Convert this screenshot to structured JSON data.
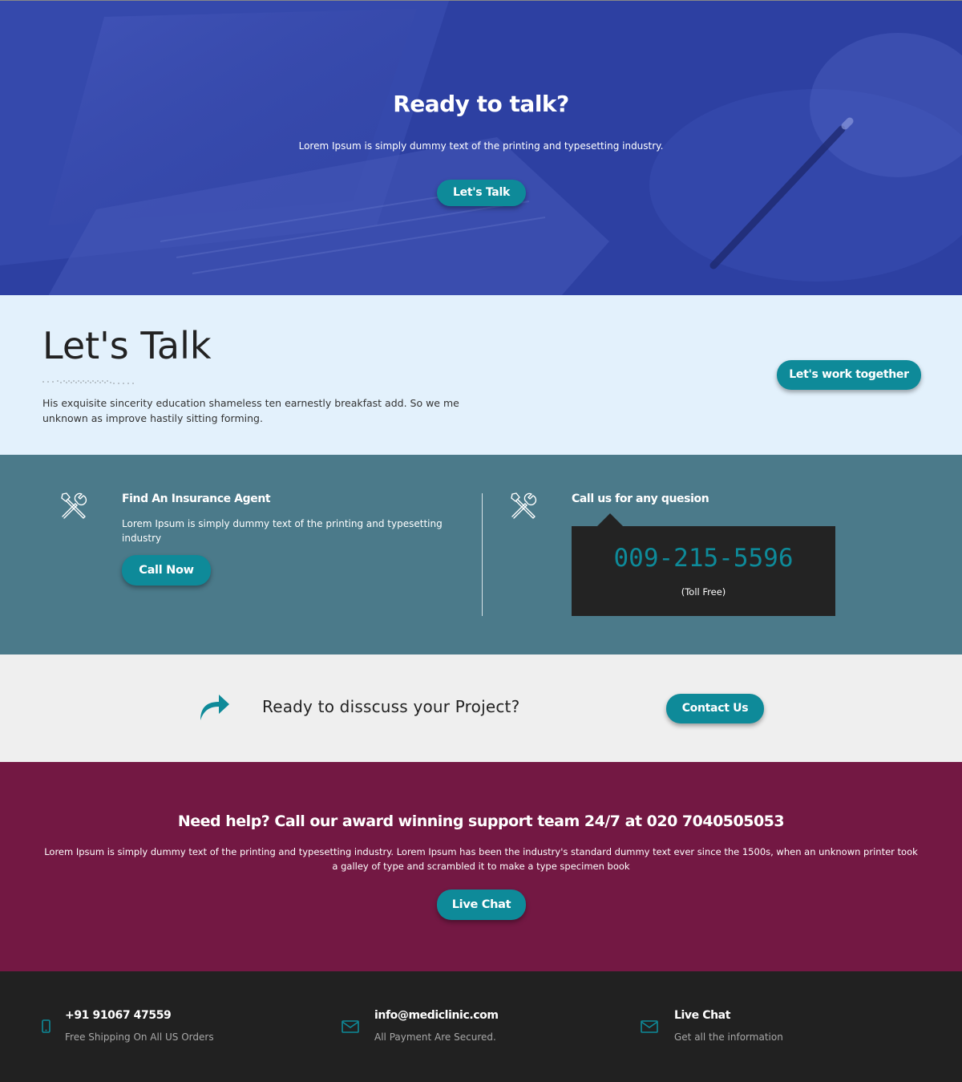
{
  "colors": {
    "accent": "#0e8a99",
    "hero_bg": "#2a3c9c",
    "talk_bg": "#e3f1fc",
    "agent_bg": "#4b7a8a",
    "project_bg": "#efefef",
    "help_bg": "#731843",
    "footer_bg": "#212121"
  },
  "hero": {
    "title": "Ready to talk?",
    "text": "Lorem Ipsum is simply dummy text of the printing and typesetting industry.",
    "button": "Let's Talk"
  },
  "talk": {
    "title": "Let's Talk",
    "text": "His exquisite sincerity education shameless ten earnestly breakfast add. So we me unknown as improve hastily sitting forming.",
    "button": "Let's work together"
  },
  "agent": {
    "left": {
      "icon": "tools-icon",
      "title": "Find An Insurance Agent",
      "text": "Lorem Ipsum is simply dummy text of the printing and typesetting industry",
      "button": "Call Now"
    },
    "right": {
      "icon": "tools-icon",
      "title": "Call us for any quesion",
      "phone": "009-215-5596",
      "phone_note": "(Toll Free)"
    }
  },
  "project": {
    "icon": "share-arrow-icon",
    "text": "Ready to disscuss your Project?",
    "button": "Contact Us"
  },
  "help": {
    "title": "Need help? Call our award winning support team 24/7 at 020 7040505053",
    "text": "Lorem Ipsum is simply dummy text of the printing and typesetting industry. Lorem Ipsum has been the industry's standard dummy text ever since the 1500s, when an unknown printer took a galley of type and scrambled it to make a type specimen book",
    "button": "Live Chat"
  },
  "footer": {
    "items": [
      {
        "icon": "mobile-phone-icon",
        "title": "+91 91067 47559",
        "subtitle": "Free Shipping On All US Orders"
      },
      {
        "icon": "envelope-icon",
        "title": "info@mediclinic.com",
        "subtitle": "All Payment Are Secured."
      },
      {
        "icon": "envelope-icon",
        "title": "Live Chat",
        "subtitle": "Get all the information"
      }
    ]
  }
}
